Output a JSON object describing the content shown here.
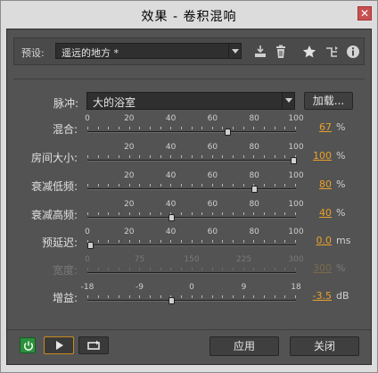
{
  "window": {
    "title": "效果 - 卷积混响",
    "close_glyph": "✕"
  },
  "preset": {
    "label": "预设:",
    "value": "遥远的地方 *"
  },
  "toolbar": {
    "icons": [
      "save-preset-icon",
      "delete-preset-icon",
      "favorite-star-icon",
      "routing-icon",
      "info-icon"
    ]
  },
  "impulse": {
    "label": "脉冲:",
    "value": "大的浴室",
    "load_label": "加载..."
  },
  "params": [
    {
      "name": "mix",
      "label": "混合:",
      "ticks": [
        "0",
        "20",
        "40",
        "60",
        "80",
        "100"
      ],
      "min": 0,
      "max": 100,
      "value": 67,
      "value_text": "67",
      "unit": "%",
      "enabled": true
    },
    {
      "name": "room-size",
      "label": "房间大小:",
      "ticks": [
        "20",
        "40",
        "60",
        "80",
        "100"
      ],
      "min": 0,
      "max": 100,
      "value": 100,
      "value_text": "100",
      "unit": "%",
      "enabled": true
    },
    {
      "name": "damping-lf",
      "label": "衰减低频:",
      "ticks": [
        "20",
        "40",
        "60",
        "80",
        "100"
      ],
      "min": 0,
      "max": 100,
      "value": 80,
      "value_text": "80",
      "unit": "%",
      "enabled": true
    },
    {
      "name": "damping-hf",
      "label": "衰减高频:",
      "ticks": [
        "20",
        "40",
        "60",
        "80",
        "100"
      ],
      "min": 0,
      "max": 100,
      "value": 40,
      "value_text": "40",
      "unit": "%",
      "enabled": true
    },
    {
      "name": "pre-delay",
      "label": "预延迟:",
      "ticks": [
        "0",
        "20",
        "40",
        "60",
        "80",
        "100"
      ],
      "min": 0,
      "max": 100,
      "value": 0,
      "value_text": "0.0",
      "unit": "ms",
      "enabled": true
    },
    {
      "name": "width",
      "label": "宽度:",
      "ticks": [
        "0",
        "75",
        "150",
        "225",
        "300"
      ],
      "min": 0,
      "max": 300,
      "value": 300,
      "value_text": "300",
      "unit": "%",
      "enabled": false
    },
    {
      "name": "gain",
      "label": "增益:",
      "ticks": [
        "-18",
        "-9",
        "0",
        "9",
        "18"
      ],
      "min": -18,
      "max": 18,
      "value": -3.5,
      "value_text": "-3.5",
      "unit": "dB",
      "enabled": true
    }
  ],
  "footer": {
    "apply_label": "应用",
    "close_label": "关闭"
  },
  "colors": {
    "accent": "#e8a128",
    "panel": "#535353",
    "power_on": "#2e8f3e"
  }
}
